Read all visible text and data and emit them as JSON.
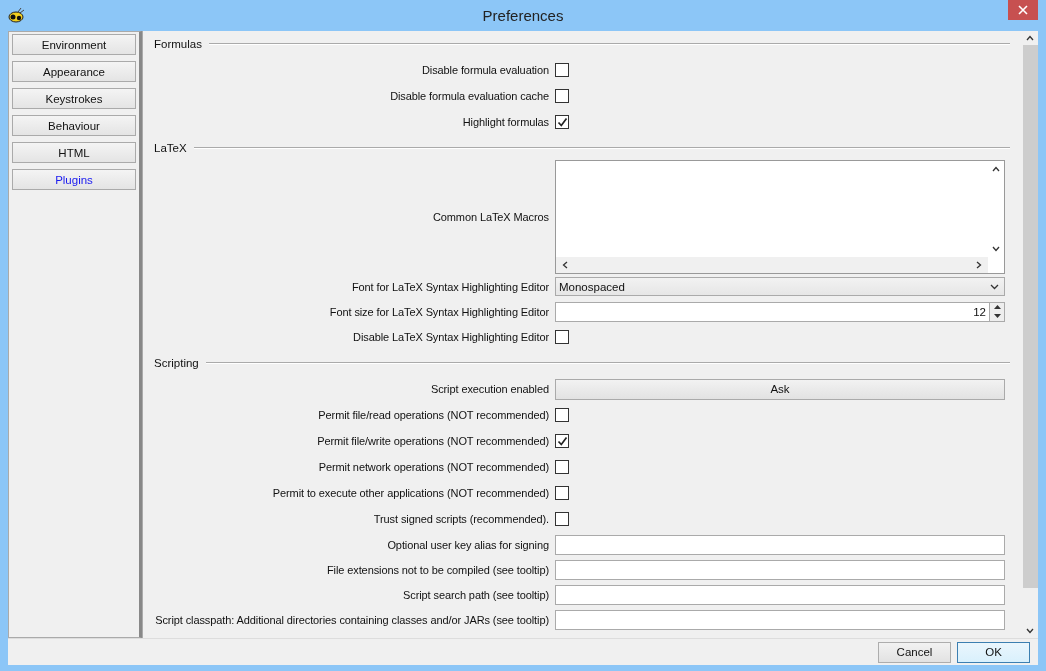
{
  "window": {
    "title": "Preferences"
  },
  "sidebar": {
    "items": [
      {
        "label": "Environment",
        "selected": false
      },
      {
        "label": "Appearance",
        "selected": false
      },
      {
        "label": "Keystrokes",
        "selected": false
      },
      {
        "label": "Behaviour",
        "selected": false
      },
      {
        "label": "HTML",
        "selected": false
      },
      {
        "label": "Plugins",
        "selected": true
      }
    ]
  },
  "sections": [
    {
      "title": "Formulas",
      "rows": [
        {
          "kind": "checkbox",
          "label": "Disable formula evaluation",
          "checked": false
        },
        {
          "kind": "checkbox",
          "label": "Disable formula evaluation cache",
          "checked": false
        },
        {
          "kind": "checkbox",
          "label": "Highlight formulas",
          "checked": true
        }
      ]
    },
    {
      "title": "LaTeX",
      "rows": [
        {
          "kind": "textarea",
          "label": "Common LaTeX Macros"
        },
        {
          "kind": "select",
          "label": "Font for LaTeX Syntax Highlighting Editor",
          "value": "Monospaced"
        },
        {
          "kind": "spinner",
          "label": "Font size for LaTeX Syntax Highlighting Editor",
          "value": "12"
        },
        {
          "kind": "checkbox",
          "label": "Disable LaTeX Syntax Highlighting Editor",
          "checked": false
        }
      ]
    },
    {
      "title": "Scripting",
      "rows": [
        {
          "kind": "button",
          "label": "Script execution enabled",
          "value": "Ask"
        },
        {
          "kind": "checkbox",
          "label": "Permit file/read operations (NOT recommended)",
          "checked": false
        },
        {
          "kind": "checkbox",
          "label": "Permit file/write operations (NOT recommended)",
          "checked": true
        },
        {
          "kind": "checkbox",
          "label": "Permit network operations (NOT recommended)",
          "checked": false
        },
        {
          "kind": "checkbox",
          "label": "Permit to execute other applications (NOT recommended)",
          "checked": false
        },
        {
          "kind": "checkbox",
          "label": "Trust signed scripts (recommended).",
          "checked": false
        },
        {
          "kind": "text",
          "label": "Optional user key alias for signing"
        },
        {
          "kind": "text",
          "label": "File extensions not to be compiled (see tooltip)"
        },
        {
          "kind": "text",
          "label": "Script search path (see tooltip)"
        },
        {
          "kind": "text",
          "label": "Script classpath: Additional directories containing classes and/or JARs (see tooltip)"
        }
      ]
    }
  ],
  "buttons": [
    {
      "label": "Cancel",
      "kind": "normal"
    },
    {
      "label": "OK",
      "kind": "default"
    }
  ]
}
